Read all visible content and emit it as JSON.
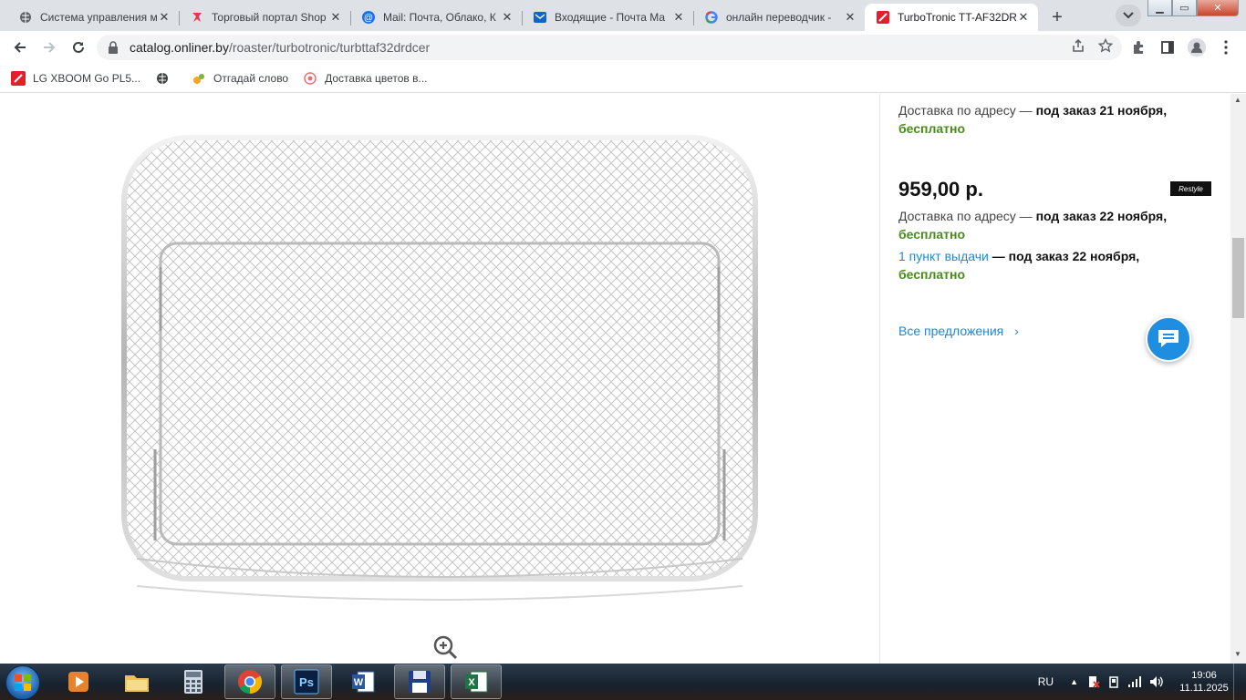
{
  "browser": {
    "tabs": [
      {
        "title": "Система управления м",
        "icon": "globe-icon"
      },
      {
        "title": "Торговый портал Shop",
        "icon": "shop-icon"
      },
      {
        "title": "Mail: Почта, Облако, К",
        "icon": "mail-at-icon"
      },
      {
        "title": "Входящие - Почта Ма",
        "icon": "envelope-icon"
      },
      {
        "title": "онлайн переводчик -",
        "icon": "google-icon"
      },
      {
        "title": "TurboTronic TT-AF32DR",
        "icon": "onliner-icon",
        "active": true
      }
    ],
    "url_host": "catalog.onliner.by",
    "url_path": "/roaster/turbotronic/turbttaf32drdcer",
    "bookmarks": [
      {
        "label": "LG XBOOM Go PL5...",
        "icon": "onliner-icon"
      },
      {
        "label": "",
        "icon": "globe-icon"
      },
      {
        "label": "Отгадай слово",
        "icon": "game-icon"
      },
      {
        "label": "Доставка цветов в...",
        "icon": "flower-icon"
      }
    ]
  },
  "offers": {
    "first": {
      "delivery_label": "Доставка по адресу — ",
      "delivery_date": "под заказ 21 ноября,",
      "delivery_cost": "бесплатно"
    },
    "second": {
      "price": "959,00 р.",
      "shop_logo": "Restyle",
      "delivery_label": "Доставка по адресу — ",
      "delivery_date": "под заказ 22 ноября,",
      "delivery_cost": "бесплатно",
      "pickup_link": "1 пункт выдачи",
      "pickup_date": " — под заказ 22 ноября,",
      "pickup_cost": "бесплатно"
    },
    "all_offers": "Все предложения",
    "all_offers_arrow": "›"
  },
  "taskbar": {
    "apps": [
      "media-player",
      "file-explorer",
      "calculator",
      "chrome",
      "photoshop",
      "word",
      "save-disk",
      "excel"
    ],
    "language": "RU",
    "time": "19:06",
    "date": "11.11.2025"
  },
  "colors": {
    "green": "#4a8a1f",
    "link": "#1a8ad8",
    "chat": "#1f8de0"
  }
}
